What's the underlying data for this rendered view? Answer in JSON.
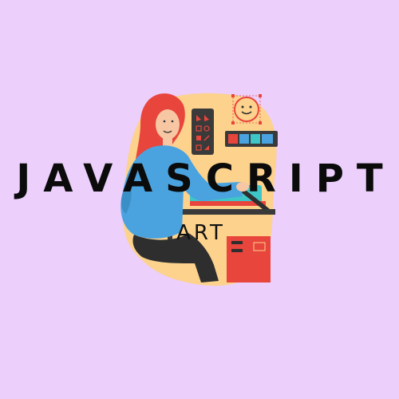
{
  "colors": {
    "background": "#eccffb",
    "blob": "#fcd28d",
    "hair": "#e8453c",
    "sweater": "#4aa3df",
    "skin": "#f7c6a3",
    "pants": "#2e2e2e",
    "panel": "#3a3a3a",
    "accent_red": "#e8453c",
    "monitor_screen": "#3ec6c6",
    "title_text": "#0b0b0b"
  },
  "illustration": {
    "subject": "woman-designer-at-desk",
    "icons": [
      "smiley-face-icon",
      "tool-palette-icon",
      "color-swatch-icon",
      "monitor-icon",
      "desk-drawer-icon"
    ]
  },
  "title": "JAVASCRIPT",
  "subtitle": "ART"
}
